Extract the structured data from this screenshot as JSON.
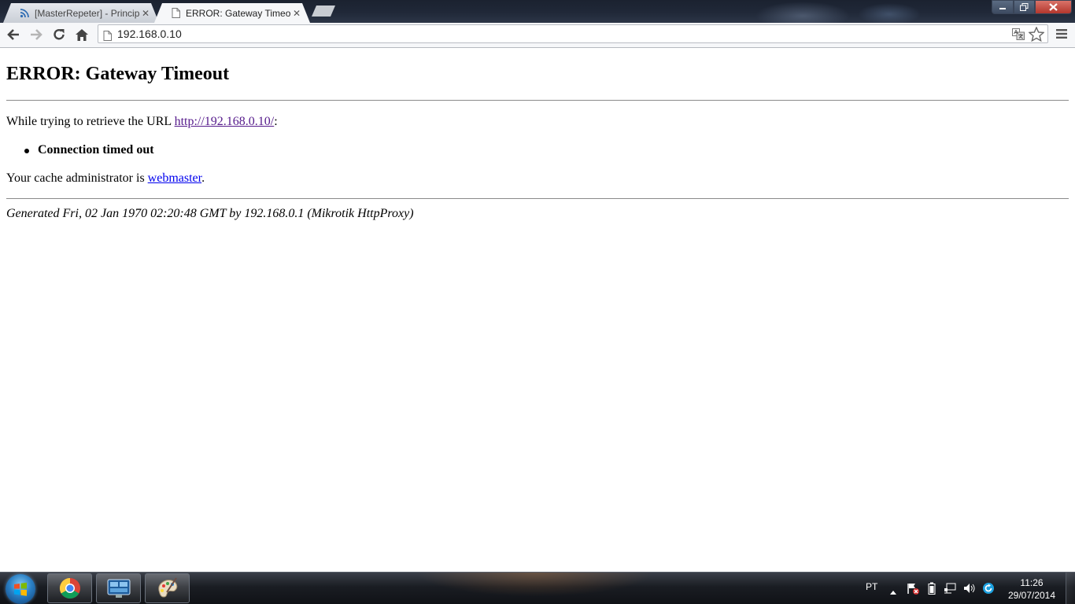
{
  "browser": {
    "tabs": [
      {
        "title": "[MasterRepeter] - Principa",
        "active": false,
        "icon": "rss-feed-icon"
      },
      {
        "title": "ERROR: Gateway Timeout",
        "active": true,
        "icon": "page-icon"
      }
    ],
    "tab_close_glyph": "✕",
    "address": "192.168.0.10"
  },
  "page": {
    "heading": "ERROR: Gateway Timeout",
    "retrieve_prefix": "While trying to retrieve the URL ",
    "retrieve_url": "http://192.168.0.10/",
    "retrieve_suffix": ":",
    "error_items": [
      "Connection timed out"
    ],
    "admin_prefix": "Your cache administrator is ",
    "admin_link": "webmaster",
    "admin_suffix": ".",
    "footer": "Generated Fri, 02 Jan 1970 02:20:48 GMT by 192.168.0.1 (Mikrotik HttpProxy)"
  },
  "taskbar": {
    "apps": [
      "chrome-icon",
      "remote-desktop-icon",
      "paint-icon"
    ],
    "language": "PT",
    "time": "11:26",
    "date": "29/07/2014"
  },
  "colors": {
    "visited_link": "#551a8b",
    "link": "#0000ee",
    "close_button": "#c0392b"
  }
}
